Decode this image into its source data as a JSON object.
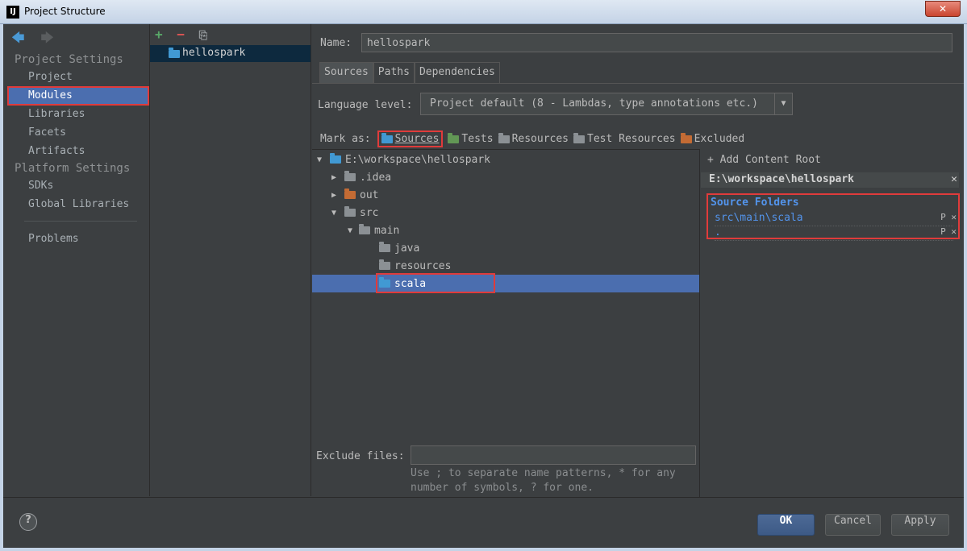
{
  "window": {
    "title": "Project Structure",
    "icon": "IJ",
    "close": "✕"
  },
  "nav": {
    "back": "🡄",
    "forward": "🡆"
  },
  "sidebar": {
    "project_settings": "Project Settings",
    "items_project": [
      "Project",
      "Modules",
      "Libraries",
      "Facets",
      "Artifacts"
    ],
    "platform_settings": "Platform Settings",
    "items_platform": [
      "SDKs",
      "Global Libraries"
    ],
    "problems": "Problems"
  },
  "modules": {
    "add": "+",
    "remove": "−",
    "copy": "⎘",
    "items": [
      "hellospark"
    ]
  },
  "module": {
    "name_label": "Name:",
    "name_value": "hellospark",
    "tabs": [
      "Sources",
      "Paths",
      "Dependencies"
    ],
    "language_label": "Language level:",
    "language_value": "Project default (8 - Lambdas, type annotations etc.)",
    "mark_as_label": "Mark as:",
    "marks": [
      "Sources",
      "Tests",
      "Resources",
      "Test Resources",
      "Excluded"
    ],
    "tree": [
      "E:\\workspace\\hellospark",
      ".idea",
      "out",
      "src",
      "main",
      "java",
      "resources",
      "scala"
    ],
    "exclude_label": "Exclude files:",
    "exclude_value": "",
    "exclude_hint": "Use ; to separate name patterns, * for any number of symbols, ? for one."
  },
  "roots": {
    "add_root": "Add Content Root",
    "root_path": "E:\\workspace\\hellospark",
    "source_folders_title": "Source Folders",
    "source_folders": [
      "src\\main\\scala",
      "."
    ]
  },
  "buttons": {
    "ok": "OK",
    "cancel": "Cancel",
    "apply": "Apply",
    "help": "?"
  }
}
